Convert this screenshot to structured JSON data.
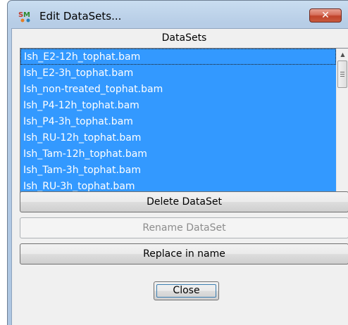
{
  "window": {
    "title": "Edit DataSets...",
    "close_glyph": "✕",
    "app_icon": "seqmonk-app-icon"
  },
  "list": {
    "header": "DataSets",
    "items": [
      "Ish_E2-12h_tophat.bam",
      "Ish_E2-3h_tophat.bam",
      "Ish_non-treated_tophat.bam",
      "Ish_P4-12h_tophat.bam",
      "Ish_P4-3h_tophat.bam",
      "Ish_RU-12h_tophat.bam",
      "Ish_Tam-12h_tophat.bam",
      "Ish_Tam-3h_tophat.bam",
      "Ish_RU-3h_tophat.bam"
    ],
    "selection_color": "#3399ff"
  },
  "buttons": {
    "delete": "Delete DataSet",
    "rename": "Rename DataSet",
    "replace": "Replace in name",
    "close": "Close"
  },
  "scrollbar": {
    "up_icon": "▲",
    "down_icon": "▼"
  }
}
